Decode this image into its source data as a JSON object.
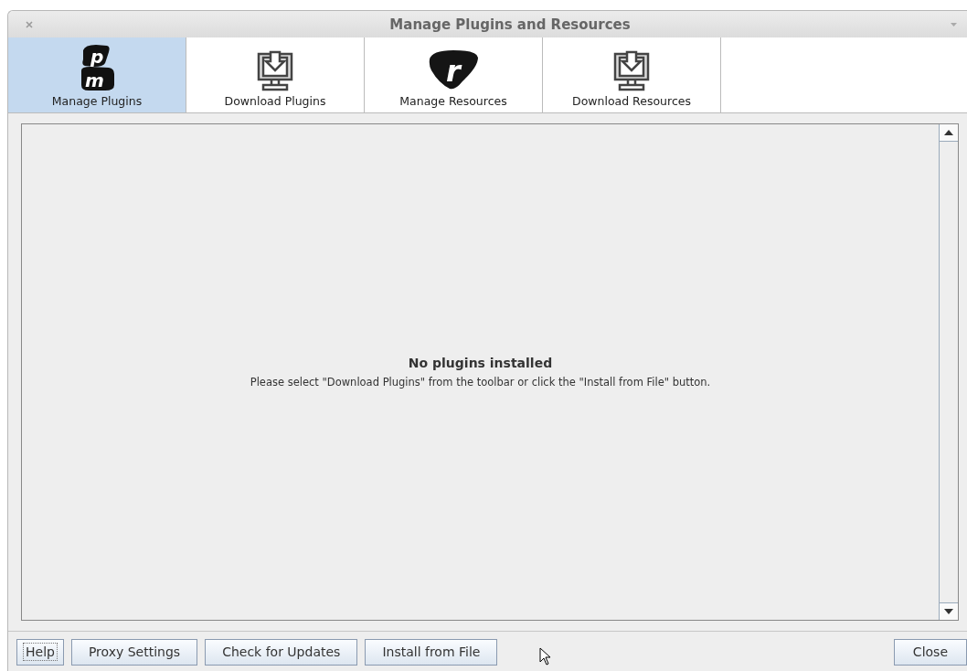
{
  "window": {
    "title": "Manage Plugins and Resources"
  },
  "tabs": [
    {
      "label": "Manage Plugins",
      "selected": true,
      "kind": "pm",
      "glyphs": [
        "p",
        "m"
      ]
    },
    {
      "label": "Download Plugins",
      "selected": false,
      "kind": "download"
    },
    {
      "label": "Manage Resources",
      "selected": false,
      "kind": "r",
      "glyphs": [
        "r"
      ]
    },
    {
      "label": "Download Resources",
      "selected": false,
      "kind": "download"
    }
  ],
  "content": {
    "heading": "No plugins installed",
    "message": "Please select \"Download Plugins\" from the toolbar or click the \"Install from File\" button."
  },
  "buttons": [
    {
      "label": "Help",
      "focused": true
    },
    {
      "label": "Proxy Settings",
      "focused": false
    },
    {
      "label": "Check for Updates",
      "focused": false
    },
    {
      "label": "Install from File",
      "focused": false
    }
  ],
  "close_button": {
    "label": "Close"
  }
}
